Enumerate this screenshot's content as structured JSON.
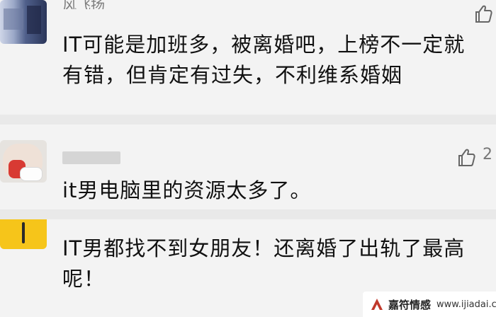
{
  "comments": [
    {
      "username": "风飞扬",
      "text": "IT可能是加班多，被离婚吧，上榜不一定就有错，但肯定有过失，不利维系婚姻",
      "like_icon": "thumbs-up-icon"
    },
    {
      "username": "",
      "text": "it男电脑里的资源太多了。",
      "like_icon": "thumbs-up-icon",
      "like_count": "2"
    },
    {
      "username": "",
      "text": "IT男都找不到女朋友！还离婚了出轨了最高呢！"
    }
  ],
  "watermark": {
    "brand": "嘉符情感",
    "url": "www.ijiadai.com",
    "logo_icon": "brand-logo-icon"
  },
  "colors": {
    "background": "#f3f3f3",
    "divider": "#e9e9e9",
    "text": "#111111",
    "muted": "#7d7d7d"
  }
}
